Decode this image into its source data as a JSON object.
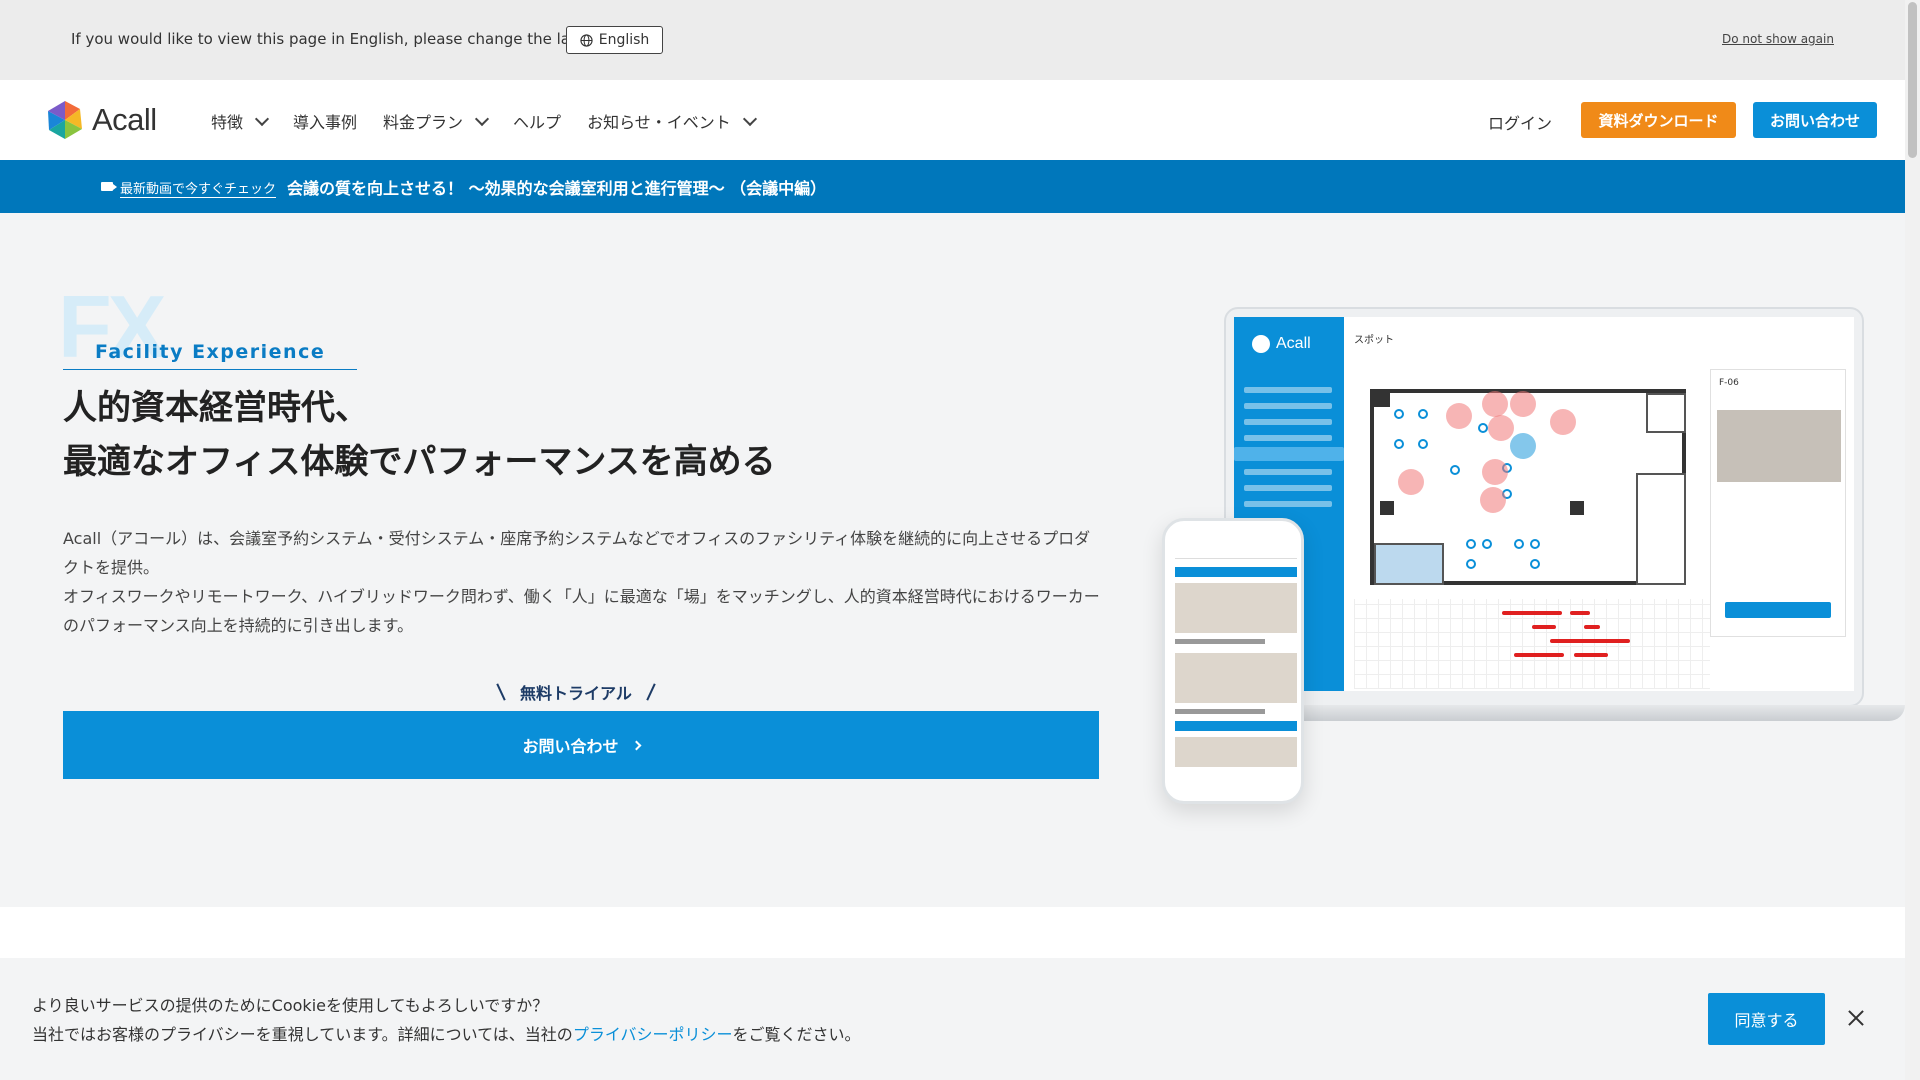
{
  "language_bar": {
    "message": "If you would like to view this page in English, please change the language.",
    "language_button": "English",
    "dont_show": "Do not show again",
    "icon": "globe-icon"
  },
  "header": {
    "logo_text": "Acall",
    "nav": [
      {
        "label": "特徴",
        "has_dropdown": true
      },
      {
        "label": "導入事例",
        "has_dropdown": false
      },
      {
        "label": "料金プラン",
        "has_dropdown": true
      },
      {
        "label": "ヘルプ",
        "has_dropdown": false
      },
      {
        "label": "お知らせ・イベント",
        "has_dropdown": true
      }
    ],
    "login": "ログイン",
    "download_button": "資料ダウンロード",
    "contact_button": "お問い合わせ"
  },
  "announcement": {
    "icon": "video-camera-icon",
    "tag": "最新動画で今すぐチェック",
    "title": "会議の質を向上させる！ 〜効果的な会議室利用と進行管理〜 （会議中編）"
  },
  "hero": {
    "fx_bg": "FX",
    "fx_label": "Facility Experience",
    "headline_line1": "人的資本経営時代、",
    "headline_line2": "最適なオフィス体験でパフォーマンスを高める",
    "description_p1": "Acall（アコール）は、会議室予約システム・受付システム・座席予約システムなどでオフィスのファシリティ体験を継続的に向上させるプロダクトを提供。",
    "description_p2": "オフィスワークやリモートワーク、ハイブリッドワーク問わず、働く「人」に最適な「場」をマッチングし、人的資本経営時代におけるワーカーのパフォーマンス向上を持続的に引き出します。",
    "trial_label": "無料トライアル",
    "cta_button": "お問い合わせ"
  },
  "mockup": {
    "app_brand": "Acall",
    "app_title": "スポット",
    "panel_title": "F-06"
  },
  "cookie": {
    "line1": "より良いサービスの提供のためにCookieを使用してもよろしいですか？",
    "line2_prefix": "当社ではお客様のプライバシーを重視しています。詳細については、当社の",
    "line2_link": "プライバシーポリシー",
    "line2_suffix": "をご覧ください。",
    "agree_button": "同意する"
  },
  "colors": {
    "primary": "#0a8fd8",
    "announcement_bg": "#0077bb",
    "download_orange": "#f08a18"
  }
}
